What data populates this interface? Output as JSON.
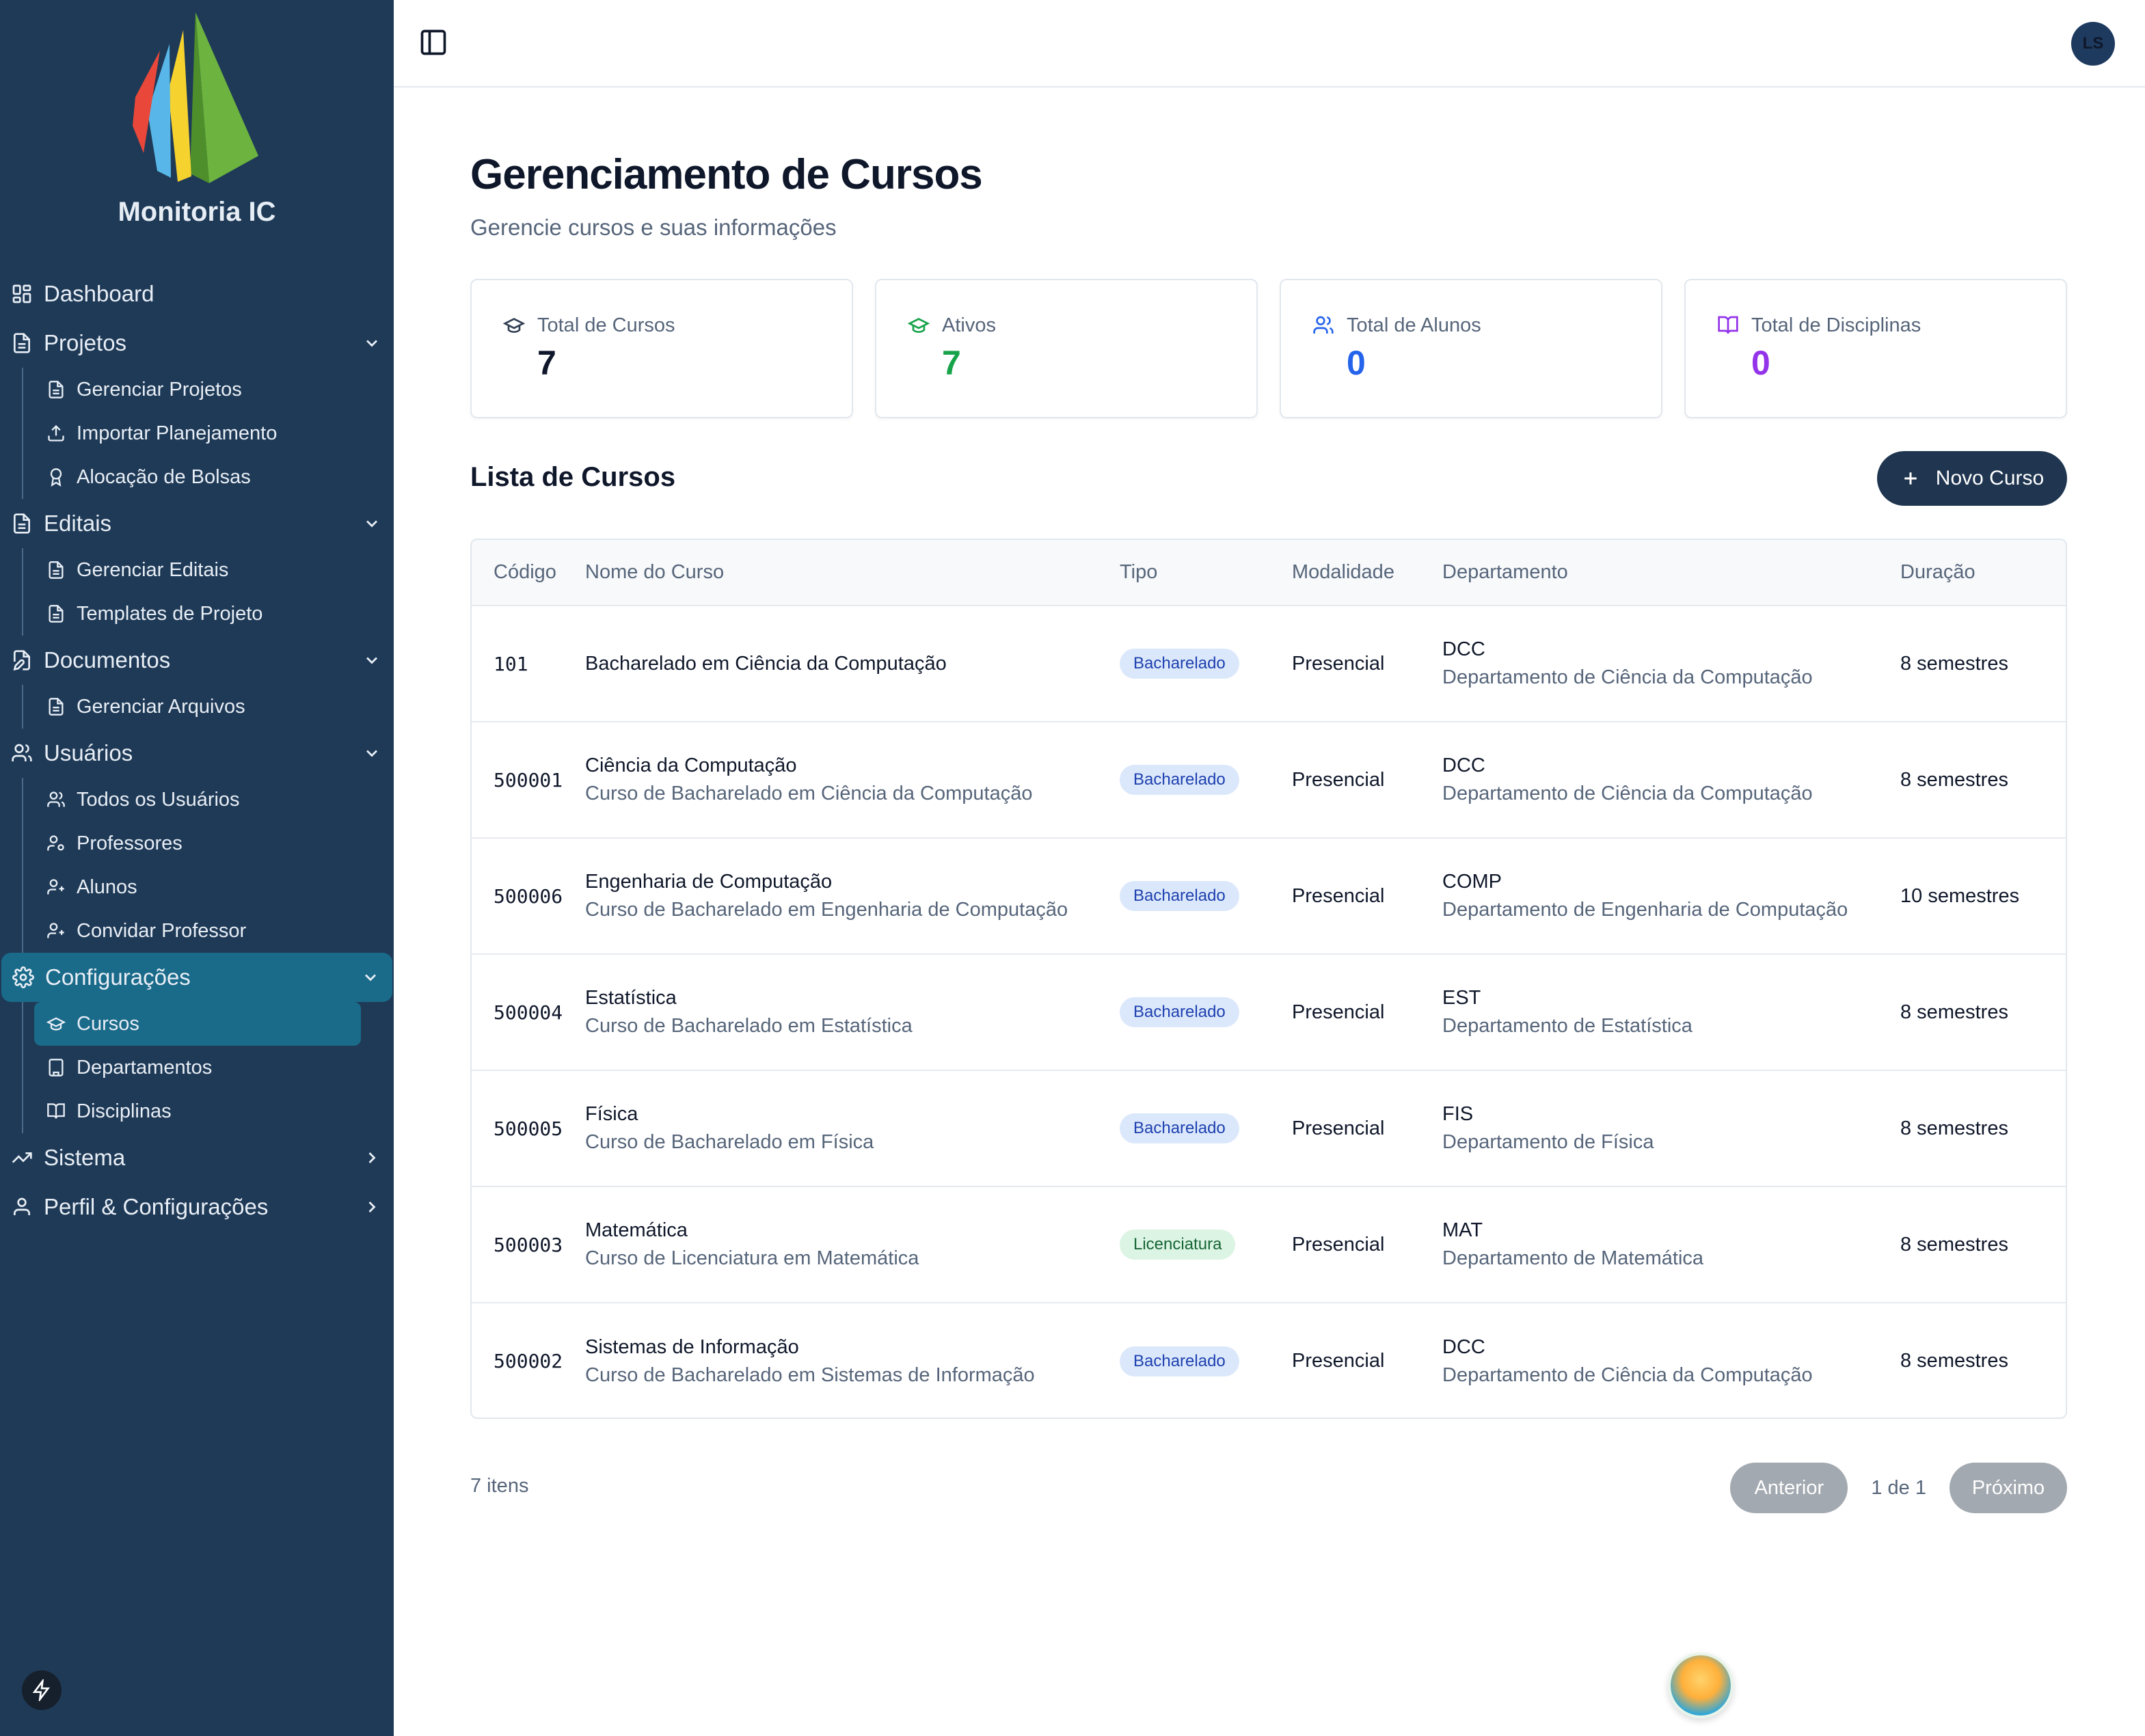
{
  "app": {
    "brand": "Monitoria IC",
    "user_initials": "LS"
  },
  "sidebar": {
    "sections": [
      {
        "label": "Dashboard",
        "icon": "dashboard-icon"
      },
      {
        "label": "Projetos",
        "icon": "file-icon",
        "items": [
          {
            "label": "Gerenciar Projetos",
            "icon": "file-icon"
          },
          {
            "label": "Importar Planejamento",
            "icon": "upload-icon"
          },
          {
            "label": "Alocação de Bolsas",
            "icon": "award-icon"
          }
        ]
      },
      {
        "label": "Editais",
        "icon": "file-icon",
        "items": [
          {
            "label": "Gerenciar Editais",
            "icon": "file-icon"
          },
          {
            "label": "Templates de Projeto",
            "icon": "file-icon"
          }
        ]
      },
      {
        "label": "Documentos",
        "icon": "file-edit-icon",
        "items": [
          {
            "label": "Gerenciar Arquivos",
            "icon": "file-icon"
          }
        ]
      },
      {
        "label": "Usuários",
        "icon": "users-icon",
        "items": [
          {
            "label": "Todos os Usuários",
            "icon": "users-icon"
          },
          {
            "label": "Professores",
            "icon": "user-cog-icon"
          },
          {
            "label": "Alunos",
            "icon": "user-plus-icon"
          },
          {
            "label": "Convidar Professor",
            "icon": "user-plus-icon"
          }
        ]
      },
      {
        "label": "Configurações",
        "icon": "gear-icon",
        "items": [
          {
            "label": "Cursos",
            "icon": "graduation-cap-icon"
          },
          {
            "label": "Departamentos",
            "icon": "building-icon"
          },
          {
            "label": "Disciplinas",
            "icon": "book-open-icon"
          }
        ]
      },
      {
        "label": "Sistema",
        "icon": "trending-up-icon"
      },
      {
        "label": "Perfil & Configurações",
        "icon": "user-icon"
      }
    ]
  },
  "page": {
    "title": "Gerenciamento de Cursos",
    "subtitle": "Gerencie cursos e suas informações"
  },
  "stats": [
    {
      "label": "Total de Cursos",
      "value": "7",
      "color": "#0f172a",
      "icon": "graduation-cap-icon",
      "icon_color": "#334155"
    },
    {
      "label": "Ativos",
      "value": "7",
      "color": "#16a34a",
      "icon": "graduation-cap-icon",
      "icon_color": "#16a34a"
    },
    {
      "label": "Total de Alunos",
      "value": "0",
      "color": "#2563eb",
      "icon": "users-icon",
      "icon_color": "#2563eb"
    },
    {
      "label": "Total de Disciplinas",
      "value": "0",
      "color": "#9333ea",
      "icon": "book-open-icon",
      "icon_color": "#9333ea"
    }
  ],
  "list": {
    "title": "Lista de Cursos",
    "new_button": "Novo Curso",
    "headers": [
      "Código",
      "Nome do Curso",
      "Tipo",
      "Modalidade",
      "Departamento",
      "Duração"
    ],
    "rows": [
      {
        "code": "101",
        "name": "Bacharelado em Ciência da Computação",
        "desc": "",
        "type": "Bacharelado",
        "mode": "Presencial",
        "dept": "DCC",
        "dept_name": "Departamento de Ciência da Computação",
        "duration": "8 semestres"
      },
      {
        "code": "500001",
        "name": "Ciência da Computação",
        "desc": "Curso de Bacharelado em Ciência da Computação",
        "type": "Bacharelado",
        "mode": "Presencial",
        "dept": "DCC",
        "dept_name": "Departamento de Ciência da Computação",
        "duration": "8 semestres"
      },
      {
        "code": "500006",
        "name": "Engenharia de Computação",
        "desc": "Curso de Bacharelado em Engenharia de Computação",
        "type": "Bacharelado",
        "mode": "Presencial",
        "dept": "COMP",
        "dept_name": "Departamento de Engenharia de Computação",
        "duration": "10 semestres"
      },
      {
        "code": "500004",
        "name": "Estatística",
        "desc": "Curso de Bacharelado em Estatística",
        "type": "Bacharelado",
        "mode": "Presencial",
        "dept": "EST",
        "dept_name": "Departamento de Estatística",
        "duration": "8 semestres"
      },
      {
        "code": "500005",
        "name": "Física",
        "desc": "Curso de Bacharelado em Física",
        "type": "Bacharelado",
        "mode": "Presencial",
        "dept": "FIS",
        "dept_name": "Departamento de Física",
        "duration": "8 semestres"
      },
      {
        "code": "500003",
        "name": "Matemática",
        "desc": "Curso de Licenciatura em Matemática",
        "type": "Licenciatura",
        "mode": "Presencial",
        "dept": "MAT",
        "dept_name": "Departamento de Matemática",
        "duration": "8 semestres"
      },
      {
        "code": "500002",
        "name": "Sistemas de Informação",
        "desc": "Curso de Bacharelado em Sistemas de Informação",
        "type": "Bacharelado",
        "mode": "Presencial",
        "dept": "DCC",
        "dept_name": "Departamento de Ciência da Computação",
        "duration": "8 semestres"
      }
    ]
  },
  "pagination": {
    "count": "7 itens",
    "prev": "Anterior",
    "info": "1 de 1",
    "next": "Próximo"
  }
}
